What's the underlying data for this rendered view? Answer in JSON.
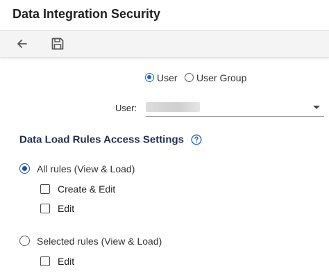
{
  "window": {
    "title": "Data Integration Security"
  },
  "toolbar": {
    "back_icon": "arrow-left-icon",
    "save_icon": "floppy-disk-icon"
  },
  "scope": {
    "options": [
      {
        "label": "User",
        "selected": true
      },
      {
        "label": "User Group",
        "selected": false
      }
    ]
  },
  "user_field": {
    "label": "User:",
    "value_redacted": true
  },
  "section": {
    "title": "Data Load Rules Access Settings",
    "help_icon": "help-circle-icon"
  },
  "rules": {
    "all": {
      "label": "All rules (View & Load)",
      "selected": true,
      "checkboxes": [
        {
          "label": "Create & Edit",
          "checked": false
        },
        {
          "label": "Edit",
          "checked": false
        }
      ]
    },
    "selected": {
      "label": "Selected rules (View & Load)",
      "selected": false,
      "checkboxes": [
        {
          "label": "Edit",
          "checked": false
        }
      ]
    }
  },
  "colors": {
    "accent": "#1a66c9",
    "heading": "#1f2b4d",
    "toolbar_bg": "#f4f4f4"
  }
}
